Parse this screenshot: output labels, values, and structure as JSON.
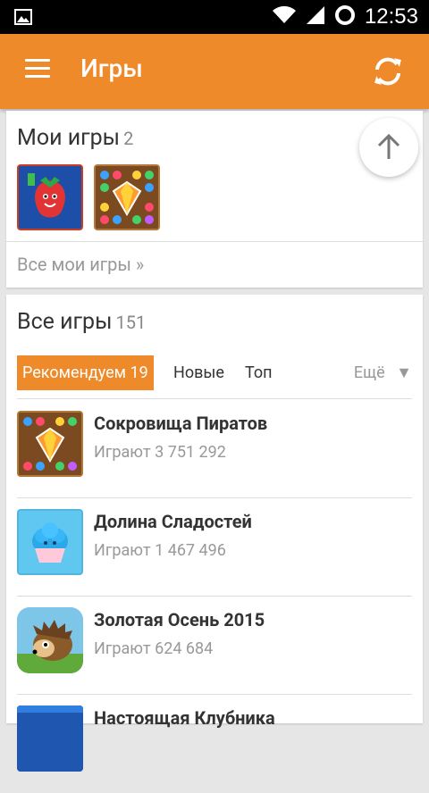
{
  "status_bar": {
    "time": "12:53",
    "icons": [
      "image-notification-icon",
      "wifi-icon",
      "signal-icon",
      "sync-icon"
    ]
  },
  "app_bar": {
    "title": "Игры",
    "menu_icon": "hamburger-menu-icon",
    "refresh_icon": "refresh-icon",
    "color": "#ef8a2b"
  },
  "my_games": {
    "title": "Мои игры",
    "count": "2",
    "games": [
      {
        "icon": "strawberry-game-icon"
      },
      {
        "icon": "gems-game-icon"
      }
    ],
    "all_link": "Все мои игры »"
  },
  "all_games": {
    "title": "Все игры",
    "count": "151",
    "tabs": {
      "active": "Рекомендуем 19",
      "new": "Новые",
      "top": "Топ",
      "more": "Ещё",
      "more_icon": "triangle-down-icon"
    },
    "list": [
      {
        "name": "Сокровища Пиратов",
        "plays": "Играют 3 751 292",
        "icon": "gems-game-icon"
      },
      {
        "name": "Долина Сладостей",
        "plays": "Играют 1 467 496",
        "icon": "cupcake-game-icon"
      },
      {
        "name": "Золотая Осень 2015",
        "plays": "Играют 624 684",
        "icon": "hedgehog-game-icon"
      },
      {
        "name": "Настоящая Клубника",
        "plays": "",
        "icon": "blue-game-icon"
      }
    ]
  },
  "scroll_up_icon": "arrow-up-icon"
}
